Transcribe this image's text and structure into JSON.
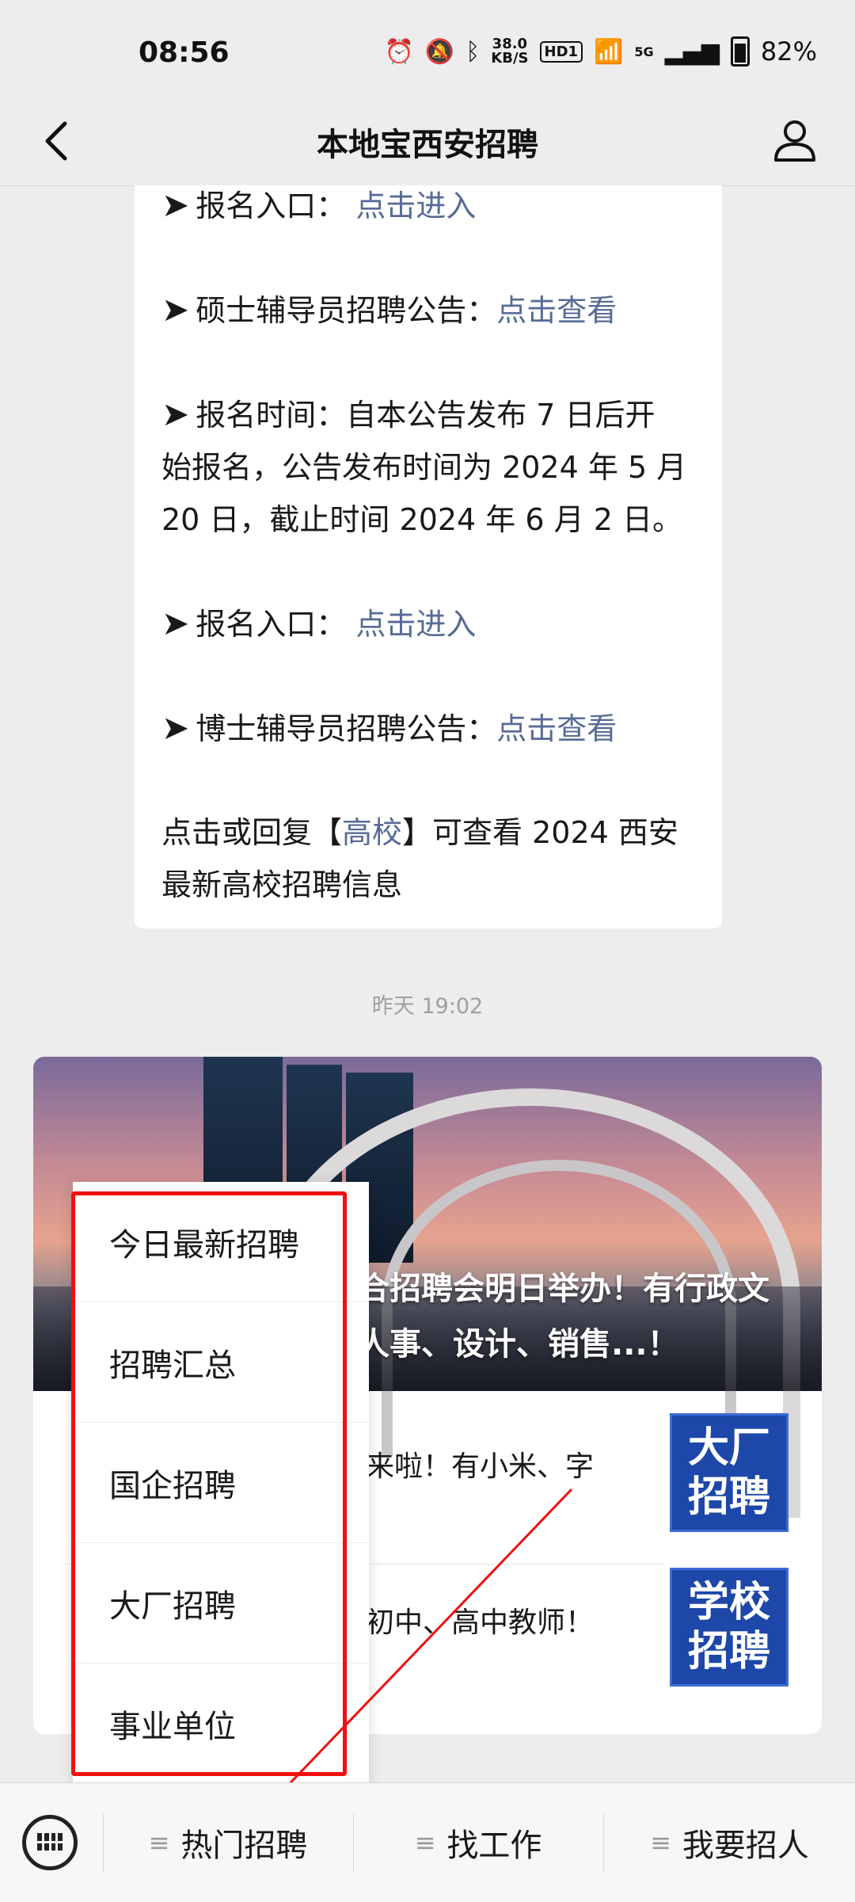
{
  "status_bar": {
    "time": "08:56",
    "speed_value": "38.0",
    "speed_unit": "KB/S",
    "hd_label": "HD1",
    "net_label": "5G",
    "battery": "82%"
  },
  "header": {
    "title": "本地宝西安招聘"
  },
  "message": {
    "line1_label": "报名入口：",
    "line1_link": "点击进入",
    "line2_label": "硕士辅导员招聘公告：",
    "line2_link": "点击查看",
    "para_line1": "报名时间：自本公告发布 7 日后开",
    "para_line2": "始报名，公告发布时间为 2024 年 5 月",
    "para_line3": "20 日，截止时间 2024 年 6 月 2 日。",
    "line4_label": "报名入口：",
    "line4_link": "点击进入",
    "line5_label": "博士辅导员招聘公告：",
    "line5_link": "点击查看",
    "footer_pre": "点击或回复【",
    "footer_link": "高校",
    "footer_post": "】可查看 2024 西安",
    "footer_line2": "最新高校招聘信息"
  },
  "timestamp": "昨天 19:02",
  "article": {
    "cover_title_line1": "合招聘会明日举办！有行政文",
    "cover_title_line2": "人事、设计、销售...！",
    "items": [
      {
        "text": "来啦！有小米、字",
        "thumb_line1": "大厂",
        "thumb_line2": "招聘"
      },
      {
        "text": "初中、高中教师！",
        "thumb_line1": "学校",
        "thumb_line2": "招聘"
      }
    ]
  },
  "popup_menu": {
    "items": [
      "今日最新招聘",
      "招聘汇总",
      "国企招聘",
      "大厂招聘",
      "事业单位"
    ]
  },
  "bottom_menu": {
    "tabs": [
      "热门招聘",
      "找工作",
      "我要招人"
    ]
  },
  "colors": {
    "link": "#576b95",
    "highlight": "#f20f0f",
    "background": "#ededed"
  }
}
